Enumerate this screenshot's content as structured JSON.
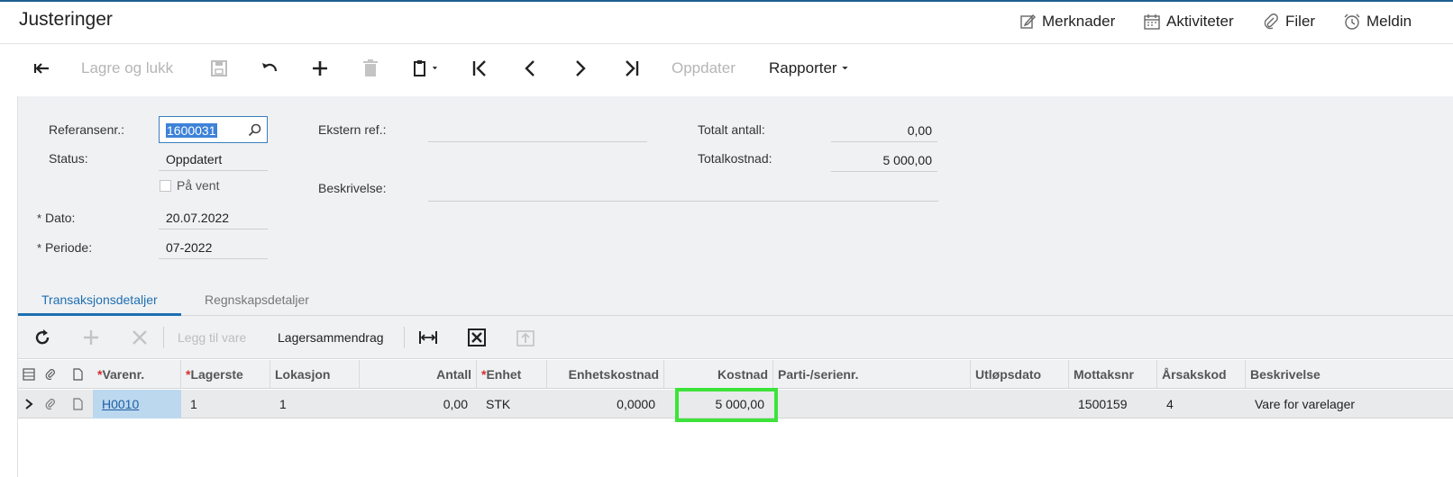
{
  "header": {
    "title": "Justeringer",
    "links": {
      "notes": "Merknader",
      "activities": "Aktiviteter",
      "files": "Filer",
      "notifications": "Meldin"
    }
  },
  "toolbar": {
    "save_close": "Lagre og lukk",
    "update": "Oppdater",
    "reports": "Rapporter"
  },
  "form": {
    "ref_label": "Referansenr.:",
    "ref_value": "1600031",
    "status_label": "Status:",
    "status_value": "Oppdatert",
    "hold_label": "På vent",
    "date_label": "Dato:",
    "date_value": "20.07.2022",
    "period_label": "Periode:",
    "period_value": "07-2022",
    "ext_ref_label": "Ekstern ref.:",
    "ext_ref_value": "",
    "desc_label": "Beskrivelse:",
    "desc_value": "",
    "total_qty_label": "Totalt antall:",
    "total_qty_value": "0,00",
    "total_cost_label": "Totalkostnad:",
    "total_cost_value": "5 000,00",
    "required_marker": "*"
  },
  "tabs": [
    {
      "label": "Transaksjonsdetaljer",
      "active": true
    },
    {
      "label": "Regnskapsdetaljer",
      "active": false
    }
  ],
  "grid_toolbar": {
    "add_item": "Legg til vare",
    "stock_summary": "Lagersammendrag"
  },
  "grid": {
    "columns": {
      "item": "Varenr.",
      "warehouse": "Lagerste",
      "location": "Lokasjon",
      "qty": "Antall",
      "uom": "Enhet",
      "unit_cost": "Enhetskostnad",
      "cost": "Kostnad",
      "lot": "Parti-/serienr.",
      "expiry": "Utløpsdato",
      "receipt": "Mottaksnr",
      "reason": "Årsakskod",
      "description": "Beskrivelse"
    },
    "rows": [
      {
        "item": "H0010",
        "warehouse": "1",
        "location": "1",
        "qty": "0,00",
        "uom": "STK",
        "unit_cost": "0,0000",
        "cost": "5 000,00",
        "lot": "",
        "expiry": "",
        "receipt": "1500159",
        "reason": "4",
        "description": "Vare for varelager"
      }
    ]
  },
  "colors": {
    "accent": "#1e6fb0",
    "highlight": "#3ce33a"
  }
}
